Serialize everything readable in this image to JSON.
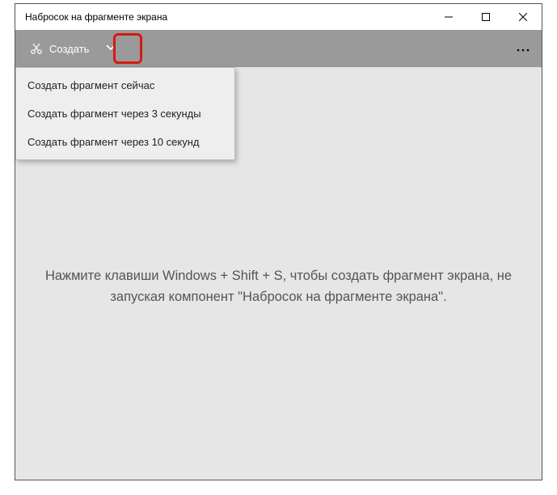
{
  "window": {
    "title": "Набросок на фрагменте экрана"
  },
  "toolbar": {
    "create_label": "Создать"
  },
  "menu": {
    "items": [
      {
        "label": "Создать фрагмент сейчас"
      },
      {
        "label": "Создать фрагмент через 3 секунды"
      },
      {
        "label": "Создать фрагмент через 10 секунд"
      }
    ]
  },
  "hint": {
    "text": "Нажмите клавиши Windows + Shift + S, чтобы создать фрагмент экрана, не запуская компонент \"Набросок на фрагменте экрана\"."
  }
}
